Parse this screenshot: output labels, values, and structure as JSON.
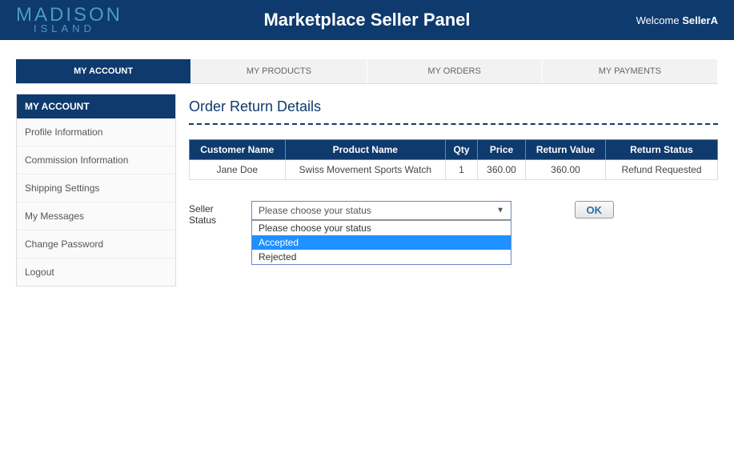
{
  "header": {
    "logo_line1": "MADISON",
    "logo_line2": "ISLAND",
    "title": "Marketplace Seller Panel",
    "welcome_prefix": "Welcome ",
    "welcome_user": "SellerA"
  },
  "nav": {
    "tabs": [
      {
        "label": "MY ACCOUNT",
        "active": true
      },
      {
        "label": "MY PRODUCTS",
        "active": false
      },
      {
        "label": "MY ORDERS",
        "active": false
      },
      {
        "label": "MY PAYMENTS",
        "active": false
      }
    ]
  },
  "sidebar": {
    "header": "MY ACCOUNT",
    "items": [
      {
        "label": "Profile Information"
      },
      {
        "label": "Commission Information"
      },
      {
        "label": "Shipping Settings"
      },
      {
        "label": "My Messages"
      },
      {
        "label": "Change Password"
      },
      {
        "label": "Logout"
      }
    ]
  },
  "main": {
    "title": "Order Return Details",
    "table": {
      "headers": [
        "Customer Name",
        "Product Name",
        "Qty",
        "Price",
        "Return Value",
        "Return Status"
      ],
      "row": {
        "customer": "Jane Doe",
        "product": "Swiss Movement Sports Watch",
        "qty": "1",
        "price": "360.00",
        "return_value": "360.00",
        "return_status": "Refund Requested"
      }
    },
    "status": {
      "label": "Seller Status",
      "selected": "Please choose your status",
      "options": [
        {
          "label": "Please choose your status",
          "highlight": false
        },
        {
          "label": "Accepted",
          "highlight": true
        },
        {
          "label": "Rejected",
          "highlight": false
        }
      ],
      "ok_label": "OK"
    }
  }
}
